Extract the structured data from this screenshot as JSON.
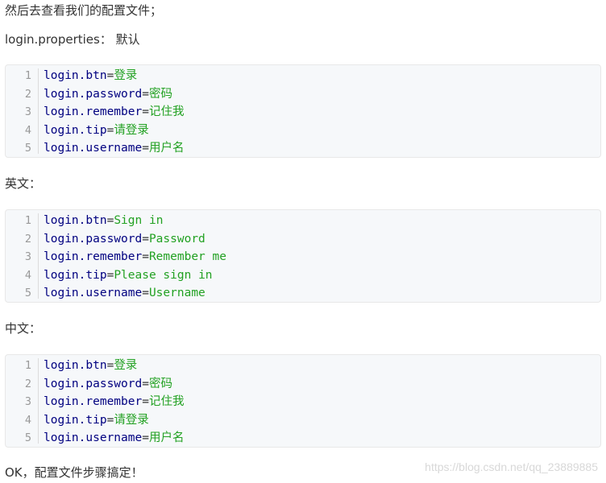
{
  "intro": "然后去查看我们的配置文件；",
  "default_label": "login.properties：  默认",
  "english_label": "英文：",
  "chinese_label": "中文：",
  "outro": "OK，配置文件步骤搞定！",
  "watermark": "https://blog.csdn.net/qq_23889885",
  "blocks": [
    {
      "lines": [
        {
          "num": "1",
          "key": "login.btn",
          "eq": "=",
          "val": "登录"
        },
        {
          "num": "2",
          "key": "login.password",
          "eq": "=",
          "val": "密码"
        },
        {
          "num": "3",
          "key": "login.remember",
          "eq": "=",
          "val": "记住我"
        },
        {
          "num": "4",
          "key": "login.tip",
          "eq": "=",
          "val": "请登录"
        },
        {
          "num": "5",
          "key": "login.username",
          "eq": "=",
          "val": "用户名"
        }
      ]
    },
    {
      "lines": [
        {
          "num": "1",
          "key": "login.btn",
          "eq": "=",
          "val": "Sign in"
        },
        {
          "num": "2",
          "key": "login.password",
          "eq": "=",
          "val": "Password"
        },
        {
          "num": "3",
          "key": "login.remember",
          "eq": "=",
          "val": "Remember me"
        },
        {
          "num": "4",
          "key": "login.tip",
          "eq": "=",
          "val": "Please sign in"
        },
        {
          "num": "5",
          "key": "login.username",
          "eq": "=",
          "val": "Username"
        }
      ]
    },
    {
      "lines": [
        {
          "num": "1",
          "key": "login.btn",
          "eq": "=",
          "val": "登录"
        },
        {
          "num": "2",
          "key": "login.password",
          "eq": "=",
          "val": "密码"
        },
        {
          "num": "3",
          "key": "login.remember",
          "eq": "=",
          "val": "记住我"
        },
        {
          "num": "4",
          "key": "login.tip",
          "eq": "=",
          "val": "请登录"
        },
        {
          "num": "5",
          "key": "login.username",
          "eq": "=",
          "val": "用户名"
        }
      ]
    }
  ],
  "colors": {
    "key": "#000080",
    "value": "#22a122",
    "line_number": "#999999",
    "code_background": "#f6f8fa"
  }
}
